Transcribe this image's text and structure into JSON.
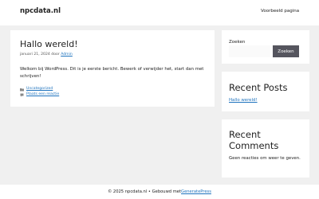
{
  "header": {
    "site_title": "npcdata.nl",
    "nav_link": "Voorbeeld pagina"
  },
  "post": {
    "title": "Hallo wereld!",
    "date": "januari 21, 2024",
    "by_label": "door",
    "author": "Admin",
    "body": "Welkom bij WordPress. Dit is je eerste bericht. Bewerk of verwijder het, start dan met schrijven!",
    "category": "Uncategorized",
    "comment_link": "Plaats een reactie",
    "category_icon": "folder-icon",
    "comment_icon": "comment-icon"
  },
  "sidebar": {
    "search_label": "Zoeken",
    "search_value": "",
    "search_button": "Zoeken",
    "recent_posts_title": "Recent Posts",
    "recent_post_link": "Hallo wereld!",
    "recent_comments_title": "Recent Comments",
    "recent_comments_text": "Geen reacties om weer te geven."
  },
  "footer": {
    "copyright": "© 2025 npcdata.nl • Gebouwd met ",
    "generator": "GeneratePress"
  },
  "colors": {
    "background": "#f0f0f0",
    "link": "#1e73be",
    "button": "#55555e"
  }
}
